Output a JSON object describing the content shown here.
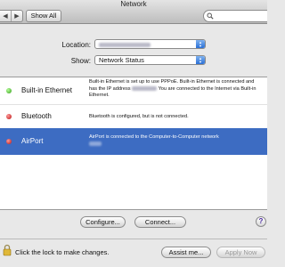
{
  "window": {
    "title": "Network"
  },
  "toolbar": {
    "back_icon": "chevron-left-icon",
    "forward_icon": "chevron-right-icon",
    "show_all_label": "Show All",
    "search_placeholder": ""
  },
  "location": {
    "label": "Location:"
  },
  "show": {
    "label": "Show:",
    "value": "Network Status"
  },
  "ports": [
    {
      "name": "Built-in Ethernet",
      "status": "green",
      "desc_before": "Built-in Ethernet is set up to use PPPoE. Built-in Ethernet is connected and has the IP address",
      "desc_after": "You are connected to the Internet via Built-in Ethernet."
    },
    {
      "name": "Bluetooth",
      "status": "red",
      "desc": "Bluetooth is configured, but is not connected."
    },
    {
      "name": "AirPort",
      "status": "red",
      "desc": "AirPort is connected to the Computer-to-Computer network"
    }
  ],
  "buttons": {
    "configure": "Configure...",
    "connect": "Connect...",
    "help": "?",
    "assist": "Assist me...",
    "apply": "Apply Now"
  },
  "lock": {
    "text": "Click the lock to make changes."
  },
  "colors": {
    "selection": "#3d6cc2",
    "status_green": "#2f9a16",
    "status_red": "#b81010"
  }
}
